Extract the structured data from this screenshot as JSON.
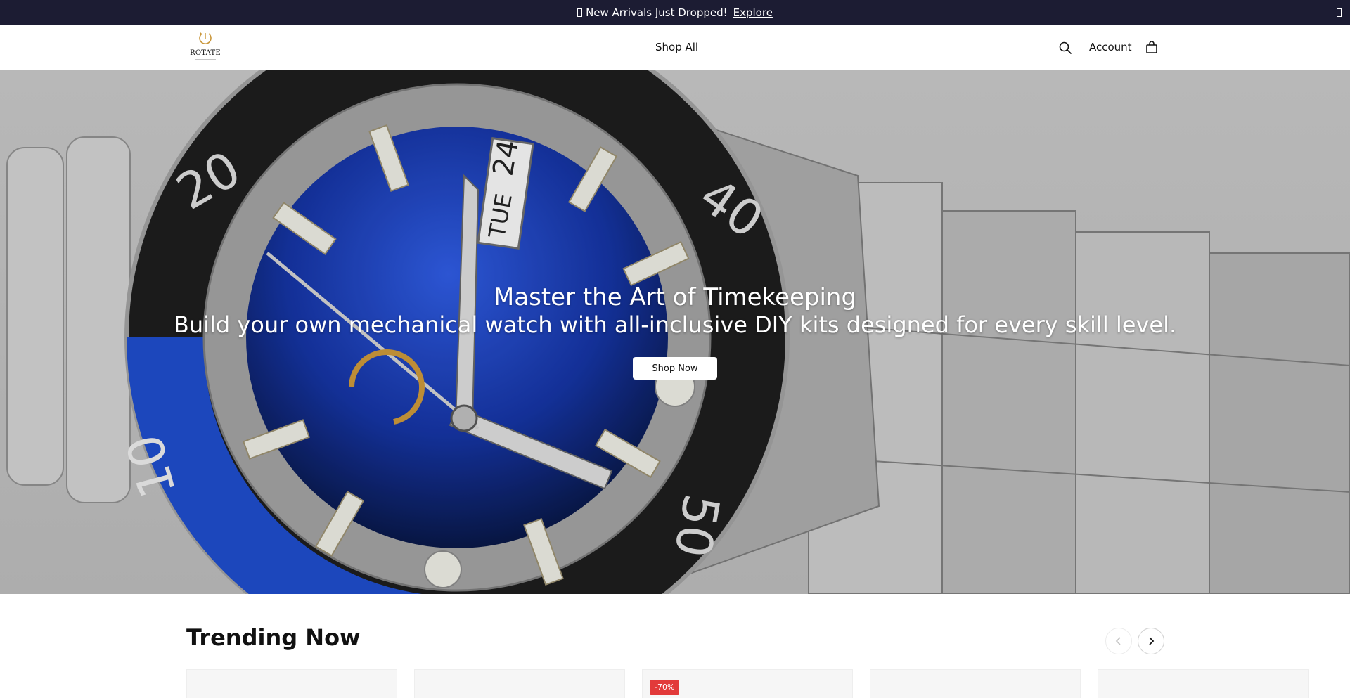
{
  "announcement": {
    "text": "New Arrivals Just Dropped!",
    "link_label": "Explore"
  },
  "header": {
    "logo_text": "ROTATE",
    "nav": {
      "shop_all": "Shop All"
    },
    "account_label": "Account"
  },
  "hero": {
    "title": "Master the Art of Timekeeping",
    "subtitle": "Build your own mechanical watch with all-inclusive DIY kits designed for every skill level.",
    "cta_label": "Shop Now",
    "bezel_numbers": [
      "20",
      "40",
      "50",
      "10"
    ],
    "date_window": "24",
    "day_window": "TUE"
  },
  "trending": {
    "title": "Trending Now",
    "discount_badge": "-70%"
  },
  "colors": {
    "announce_bg": "#1c1c33",
    "badge_bg": "#e23a3a",
    "dial_blue": "#1e3fa6",
    "logo_gold": "#c9963a"
  }
}
